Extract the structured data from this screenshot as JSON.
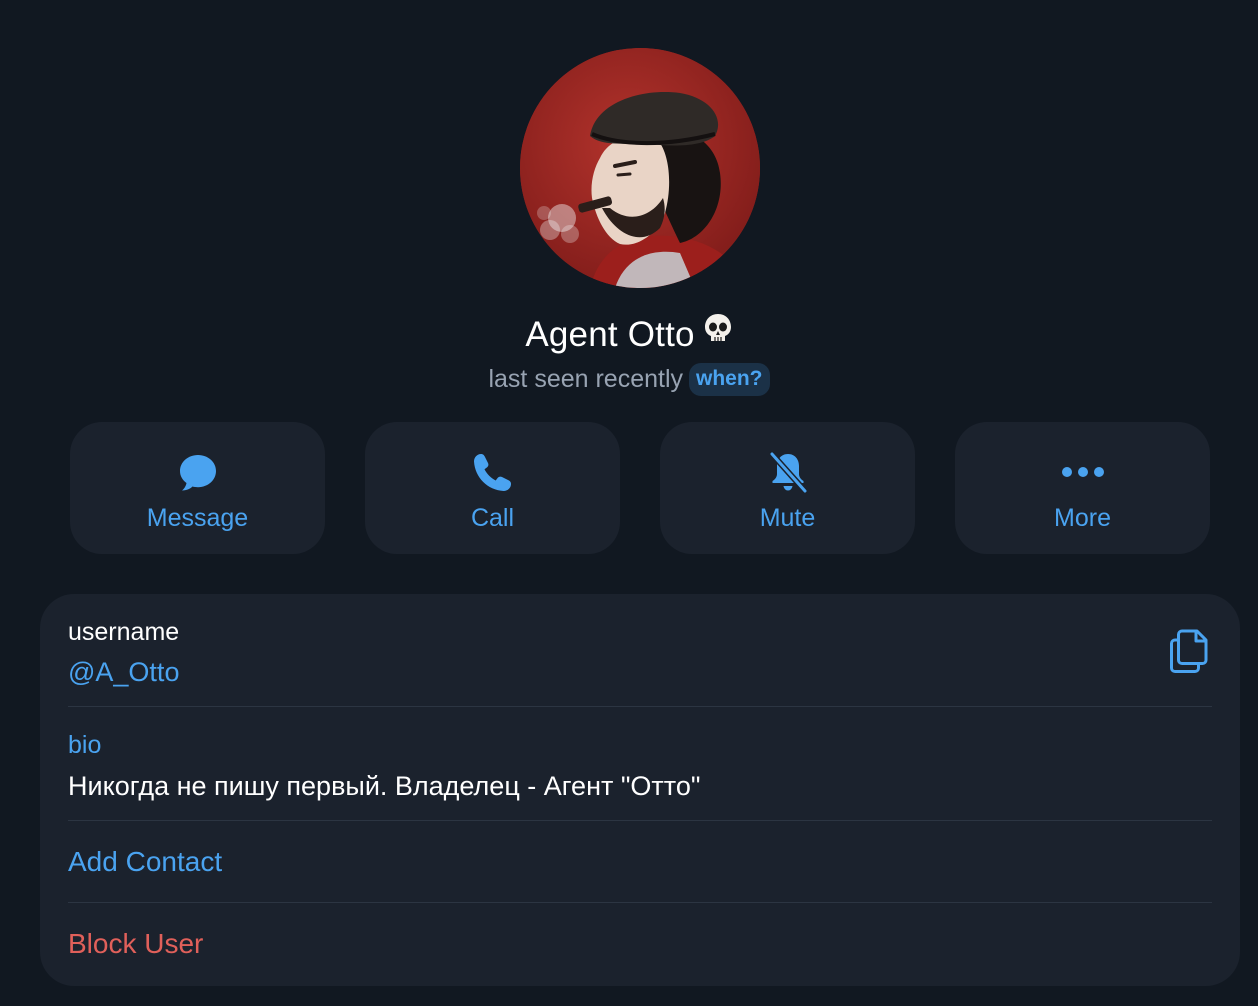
{
  "profile": {
    "name": "Agent Otto",
    "name_emoji": "skull-icon",
    "status": "last seen recently",
    "status_badge": "when?"
  },
  "actions": [
    {
      "label": "Message",
      "icon": "message-bubble-icon"
    },
    {
      "label": "Call",
      "icon": "phone-icon"
    },
    {
      "label": "Mute",
      "icon": "bell-muted-icon"
    },
    {
      "label": "More",
      "icon": "more-dots-icon"
    }
  ],
  "info": {
    "username_label": "username",
    "username_value": "@A_Otto",
    "copy_icon": "copy-icon",
    "bio_label": "bio",
    "bio_value": "Никогда не пишу первый. Владелец - Агент \"Отто\"",
    "add_contact": "Add Contact",
    "block_user": "Block User"
  },
  "colors": {
    "background": "#111821",
    "card": "#1b222d",
    "accent": "#4aa3f0",
    "danger": "#e0605a",
    "muted_text": "#98a3b2",
    "divider": "#2c3542"
  }
}
